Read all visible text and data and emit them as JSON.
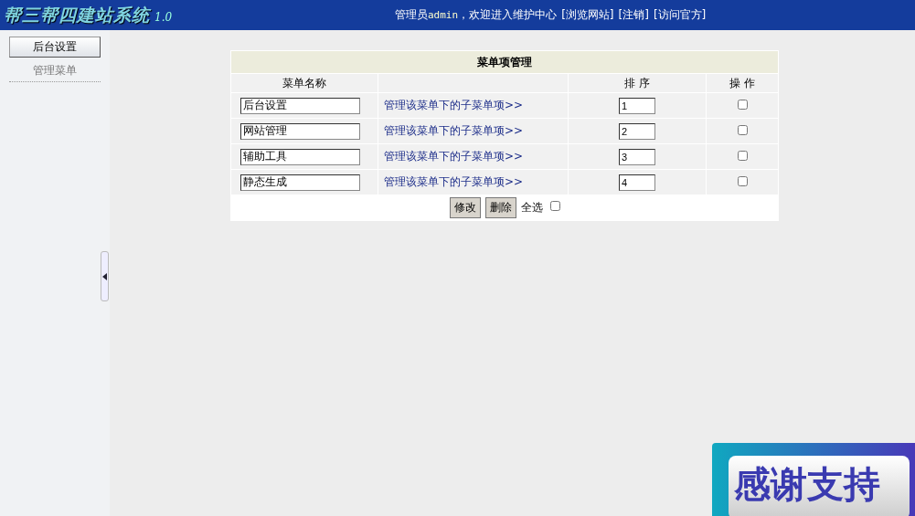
{
  "header": {
    "logo": "帮三帮四建站系统",
    "version": "1.0",
    "greeting_prefix": "管理员",
    "user": "admin",
    "greeting_suffix": "，欢迎进入维护中心",
    "links": [
      "[浏览网站]",
      "[注销]",
      "[访问官方]"
    ]
  },
  "sidebar": {
    "button": "后台设置",
    "items": [
      "管理菜单"
    ]
  },
  "table": {
    "title": "菜单项管理",
    "columns": [
      "菜单名称",
      "排 序",
      "操 作"
    ],
    "rows": [
      {
        "name": "后台设置",
        "link": "管理该菜单下的子菜单项>>",
        "order": "1",
        "checked": false
      },
      {
        "name": "网站管理",
        "link": "管理该菜单下的子菜单项>>",
        "order": "2",
        "checked": false
      },
      {
        "name": "辅助工具",
        "link": "管理该菜单下的子菜单项>>",
        "order": "3",
        "checked": false
      },
      {
        "name": "静态生成",
        "link": "管理该菜单下的子菜单项>>",
        "order": "4",
        "checked": false
      }
    ],
    "buttons": [
      "修改",
      "删除"
    ],
    "select_all": {
      "label": "全选",
      "checked": false
    }
  },
  "banner": {
    "text": "感谢支持"
  }
}
